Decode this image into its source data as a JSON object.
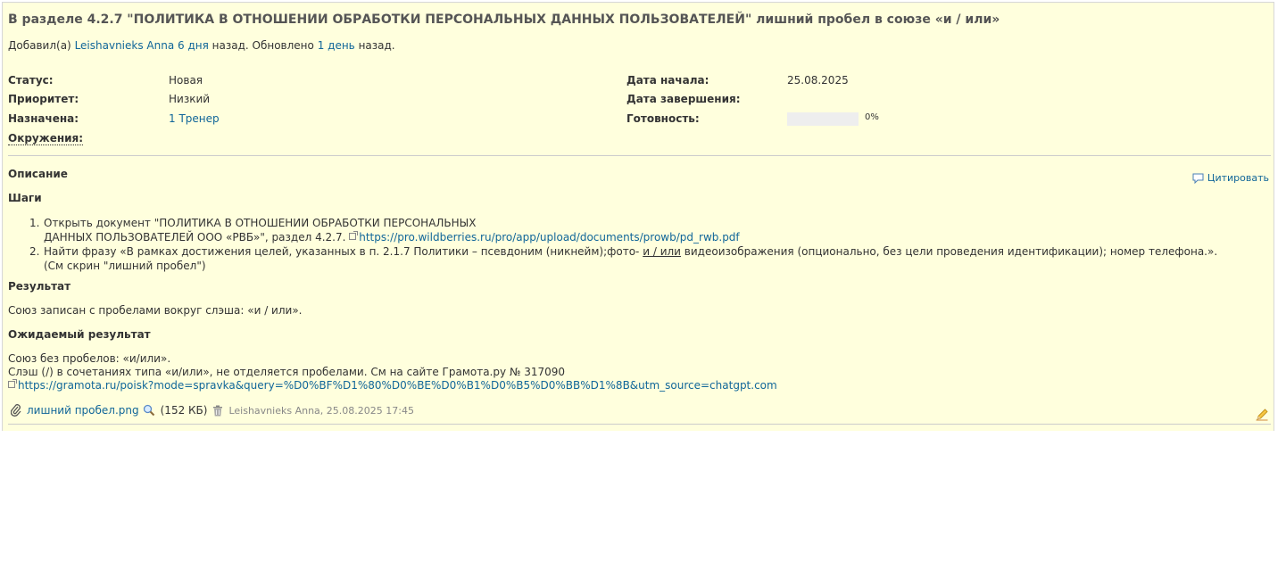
{
  "issue": {
    "title": "В разделе 4.2.7 \"ПОЛИТИКА В ОТНОШЕНИИ ОБРАБОТКИ ПЕРСОНАЛЬНЫХ ДАННЫХ ПОЛЬЗОВАТЕЛЕЙ\" лишний пробел в союзе «и / или»",
    "author_prefix": "Добавил(а)",
    "author_name": "Leishavnieks Anna",
    "added_ago": "6 дня",
    "after_added": "назад. Обновлено",
    "updated_ago": "1 день",
    "after_updated": "назад."
  },
  "attributes": {
    "status_label": "Статус:",
    "status_value": "Новая",
    "priority_label": "Приоритет:",
    "priority_value": "Низкий",
    "assigned_label": "Назначена:",
    "assigned_value": "1 Тренер",
    "environment_label": "Окружения:",
    "start_label": "Дата начала:",
    "start_value": "25.08.2025",
    "due_label": "Дата завершения:",
    "done_label": "Готовность:",
    "done_value": "0%",
    "done_fraction": 0
  },
  "description": {
    "heading": "Описание",
    "quote_label": "Цитировать",
    "steps_heading": "Шаги",
    "steps": [
      {
        "num": "1.",
        "line1": "Открыть документ \"ПОЛИТИКА В ОТНОШЕНИИ ОБРАБОТКИ ПЕРСОНАЛЬНЫХ",
        "line2": "ДАННЫХ ПОЛЬЗОВАТЕЛЕЙ ООО «РВБ»\", раздел 4.2.7.",
        "link": "https://pro.wildberries.ru/pro/app/upload/documents/prowb/pd_rwb.pdf"
      },
      {
        "num": "2.",
        "line1_before": "Найти фразу «В рамках достижения целей, указанных в п. 2.1.7 Политики – псевдоним (никнейм);фото-",
        "line1_underlined": "и / или",
        "line1_after": "видеоизображения (опционально, без цели проведения идентификации); номер телефона.».",
        "line2": "(См скрин \"лишний пробел\")"
      }
    ],
    "result_heading": "Результат",
    "result_text": "Союз записан с пробелами вокруг слэша: «и / или».",
    "expected_heading": "Ожидаемый результат",
    "expected_line1": "Союз без пробелов: «и/или».",
    "expected_line2": "Слэш (/) в сочетаниях типа «и/или», не отделяется пробелами. См на сайте Грамота.ру № 317090",
    "expected_link": "https://gramota.ru/poisk?mode=spravka&query=%D0%BF%D1%80%D0%BE%D0%B1%D0%B5%D0%BB%D1%8B&utm_source=chatgpt.com"
  },
  "attachment": {
    "filename": "лишний пробел.png",
    "size": "(152 КБ)",
    "meta": "Leishavnieks Anna, 25.08.2025 17:45"
  },
  "colors": {
    "background": "#ffffdd",
    "link": "#116699",
    "progress_track": "#eeeeee"
  },
  "icons": [
    "external-link-icon",
    "quote-icon",
    "paperclip-icon",
    "magnifier-icon",
    "trash-icon",
    "pencil-icon"
  ]
}
